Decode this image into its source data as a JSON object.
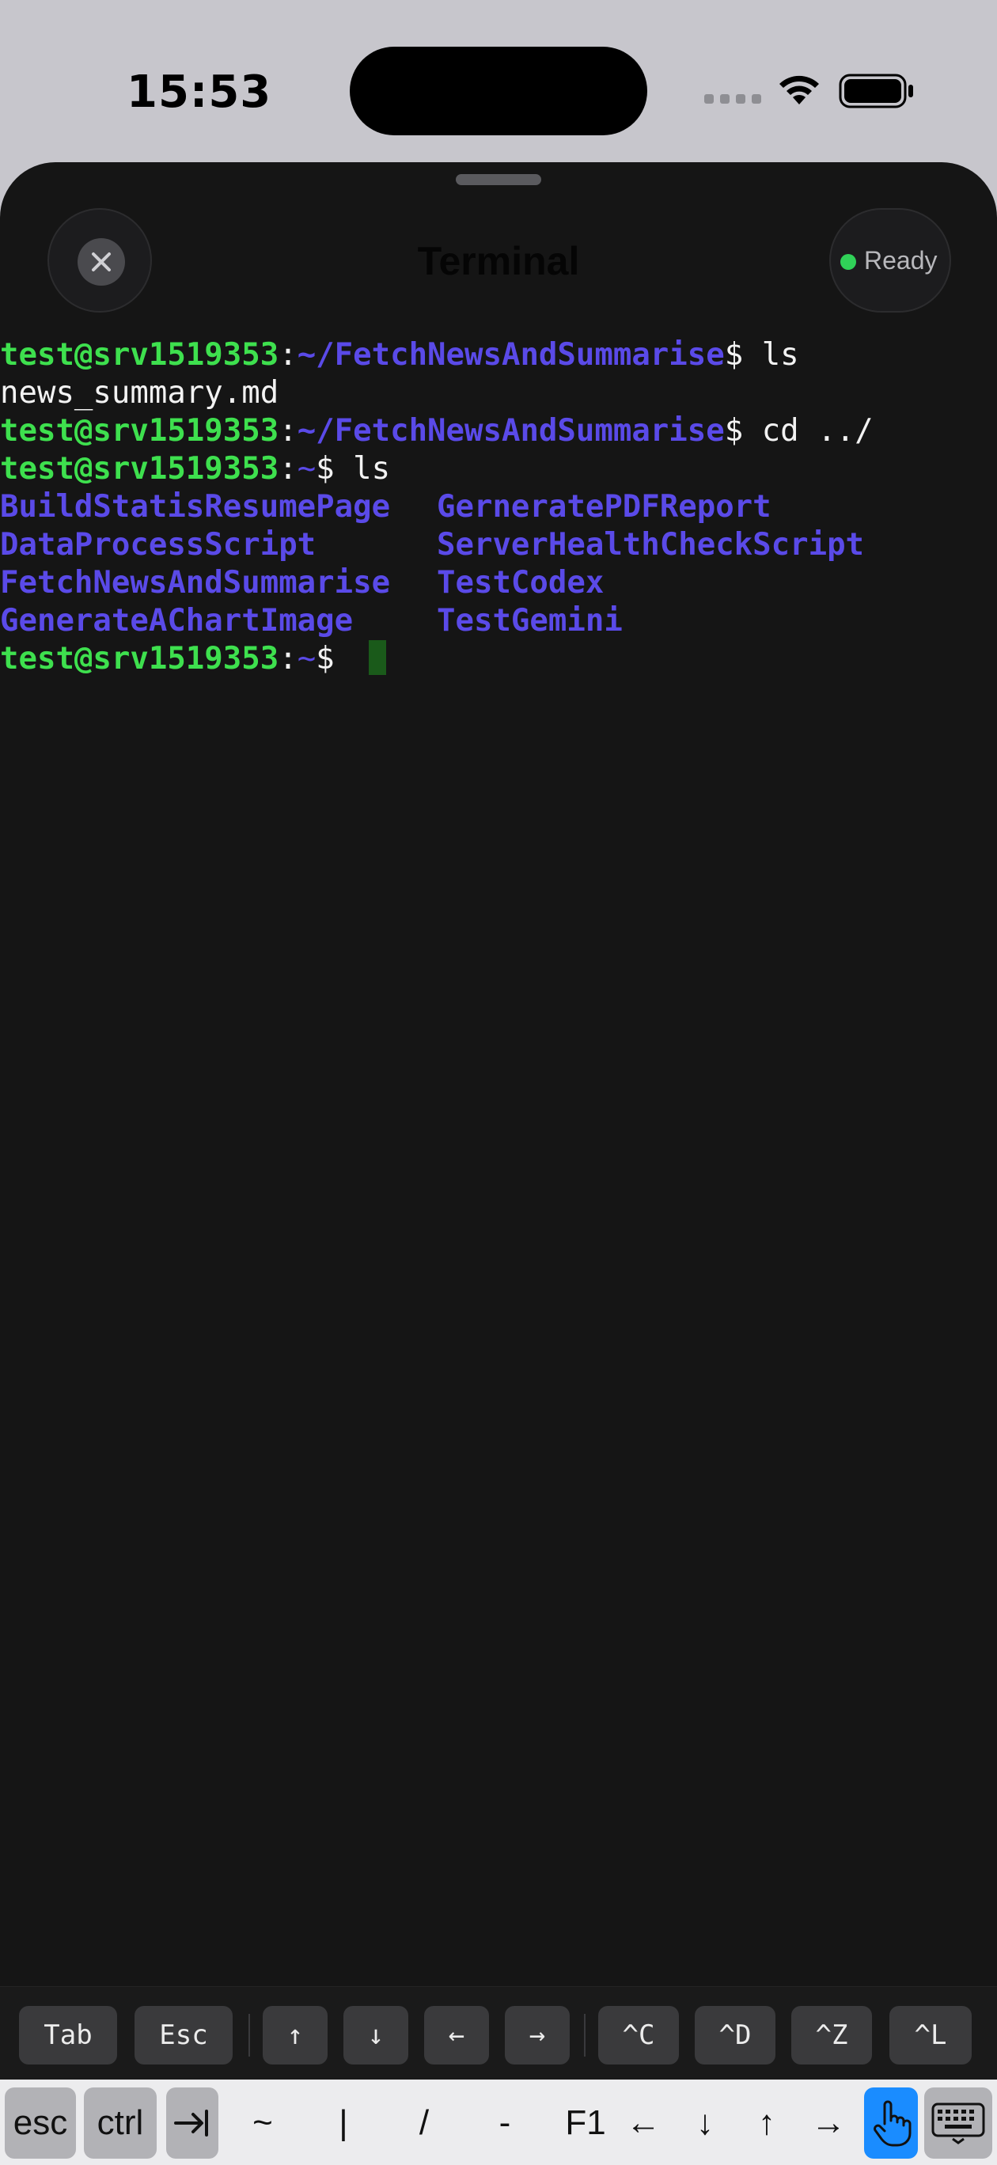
{
  "status_bar": {
    "time": "15:53"
  },
  "sheet": {
    "title": "Terminal",
    "status": "Ready",
    "status_color": "#30d158"
  },
  "terminal": {
    "lines": [
      {
        "user": "test@srv1519353",
        "sep": ":",
        "path": "~/FetchNewsAndSummarise",
        "prompt": "$ ",
        "cmd": "ls"
      },
      {
        "out": "news_summary.md"
      },
      {
        "user": "test@srv1519353",
        "sep": ":",
        "path": "~/FetchNewsAndSummarise",
        "prompt": "$ ",
        "cmd": "cd ../"
      },
      {
        "user": "test@srv1519353",
        "sep": ":",
        "path": "~",
        "prompt": "$ ",
        "cmd": "ls"
      },
      {
        "col1": "BuildStatisResumePage",
        "col2": "GerneratePDFReport"
      },
      {
        "col1": "DataProcessScript",
        "col2": "ServerHealthCheckScript"
      },
      {
        "col1": "FetchNewsAndSummarise",
        "col2": "TestCodex"
      },
      {
        "col1": "GenerateAChartImage",
        "col2": "TestGemini"
      },
      {
        "user": "test@srv1519353",
        "sep": ":",
        "path": "~",
        "prompt": "$ ",
        "cmd": ""
      }
    ],
    "colors": {
      "user": "#3ee04e",
      "dir": "#5a4ae8",
      "text": "#f2f2f2",
      "background": "#151515"
    }
  },
  "extra_keys": [
    "Tab",
    "Esc",
    "↑",
    "↓",
    "←",
    "→",
    "^C",
    "^D",
    "^Z",
    "^L"
  ],
  "keyboard_bar": {
    "esc": "esc",
    "ctrl": "ctrl",
    "tab_icon": "tab-arrow-icon",
    "tilde": "~",
    "pipe": "|",
    "slash": "/",
    "dash": "-",
    "f1": "F1",
    "left": "←",
    "down": "↓",
    "up": "↑",
    "right": "→",
    "touch_icon": "hand-pointer-icon",
    "keyboard_icon": "keyboard-icon"
  }
}
